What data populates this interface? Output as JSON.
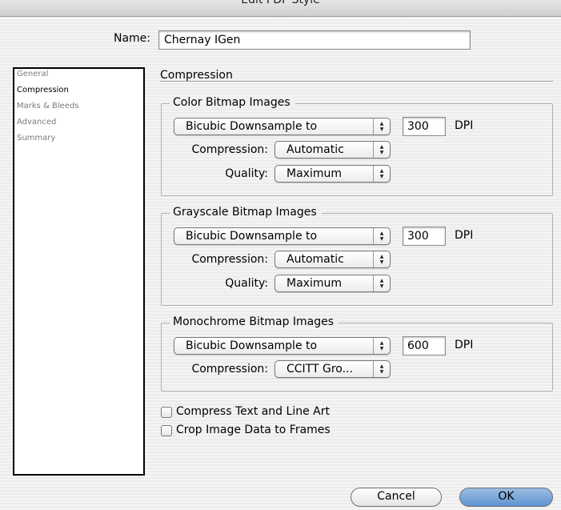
{
  "window": {
    "title": "Edit PDF Style"
  },
  "name_field": {
    "label": "Name:",
    "value": "Chernay IGen"
  },
  "sidebar": {
    "items": [
      {
        "label": "General",
        "selected": false
      },
      {
        "label": "Compression",
        "selected": true
      },
      {
        "label": "Marks & Bleeds",
        "selected": false
      },
      {
        "label": "Advanced",
        "selected": false
      },
      {
        "label": "Summary",
        "selected": false
      }
    ]
  },
  "panel": {
    "title": "Compression",
    "color_group": {
      "title": "Color Bitmap Images",
      "sampling": "Bicubic Downsample to",
      "dpi_value": "300",
      "dpi_unit": "DPI",
      "compression_label": "Compression:",
      "compression_value": "Automatic",
      "quality_label": "Quality:",
      "quality_value": "Maximum"
    },
    "grayscale_group": {
      "title": "Grayscale Bitmap Images",
      "sampling": "Bicubic Downsample to",
      "dpi_value": "300",
      "dpi_unit": "DPI",
      "compression_label": "Compression:",
      "compression_value": "Automatic",
      "quality_label": "Quality:",
      "quality_value": "Maximum"
    },
    "mono_group": {
      "title": "Monochrome Bitmap Images",
      "sampling": "Bicubic Downsample to",
      "dpi_value": "600",
      "dpi_unit": "DPI",
      "compression_label": "Compression:",
      "compression_value": "CCITT Gro..."
    },
    "checkboxes": [
      {
        "label": "Compress Text and Line Art",
        "checked": false
      },
      {
        "label": "Crop Image Data to Frames",
        "checked": false
      }
    ]
  },
  "buttons": {
    "cancel": "Cancel",
    "ok": "OK"
  },
  "colors": {
    "default_button": "#5e93d2",
    "sidebar_border": "#000000"
  },
  "icons": {
    "popup_arrows": "updown-arrows-icon",
    "checkbox": "checkbox-icon"
  }
}
